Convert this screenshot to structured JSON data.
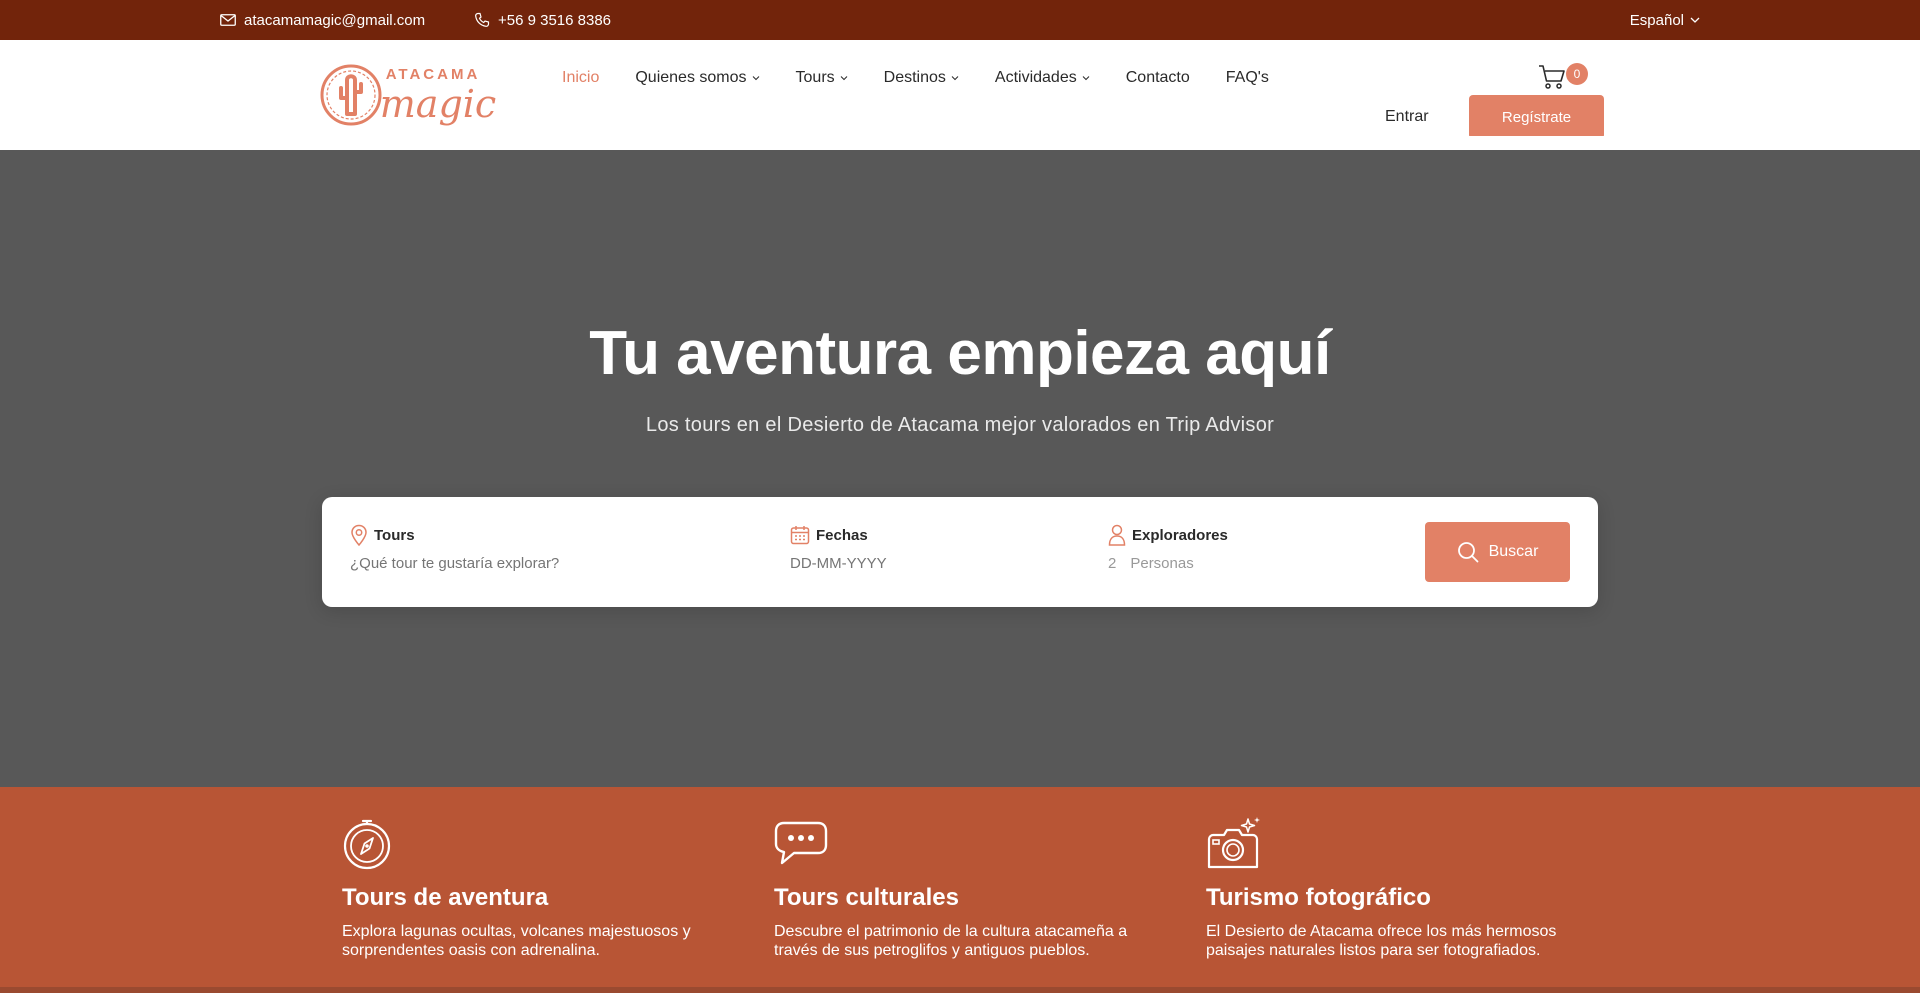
{
  "topbar": {
    "email": "atacamamagic@gmail.com",
    "phone": "+56 9 3516 8386",
    "language": "Español"
  },
  "brand": {
    "logo_top": "ATACAMA",
    "logo_main": "magic",
    "color": "#e28166"
  },
  "nav": {
    "items": [
      {
        "label": "Inicio",
        "active": true,
        "dropdown": false
      },
      {
        "label": "Quienes somos",
        "dropdown": true
      },
      {
        "label": "Tours",
        "dropdown": true
      },
      {
        "label": "Destinos",
        "dropdown": true
      },
      {
        "label": "Actividades",
        "dropdown": true
      },
      {
        "label": "Contacto",
        "dropdown": false
      },
      {
        "label": "FAQ's",
        "dropdown": false
      }
    ],
    "cart_count": "0",
    "login": "Entrar",
    "signup": "Regístrate"
  },
  "hero": {
    "title": "Tu aventura empieza aquí",
    "subtitle": "Los tours en el Desierto de Atacama mejor valorados en Trip Advisor"
  },
  "search": {
    "tours_label": "Tours",
    "tours_placeholder": "¿Qué tour te gustaría explorar?",
    "dates_label": "Fechas",
    "dates_placeholder": "DD-MM-YYYY",
    "people_label": "Exploradores",
    "people_count": "2",
    "people_unit": "Personas",
    "button": "Buscar"
  },
  "features": [
    {
      "icon": "compass-icon",
      "title": "Tours de aventura",
      "text": "Explora lagunas ocultas, volcanes majestuosos y sorprendentes oasis con adrenalina."
    },
    {
      "icon": "chat-bubble-icon",
      "title": "Tours culturales",
      "text": "Descubre el patrimonio de la cultura atacameña a través de sus petroglifos y antiguos pueblos."
    },
    {
      "icon": "camera-icon",
      "title": "Turismo fotográfico",
      "text": "El Desierto de Atacama ofrece los más hermosos paisajes naturales listos para ser fotografiados."
    }
  ],
  "colors": {
    "topbar": "#72240b",
    "accent": "#e28166",
    "hero_bg": "#585858",
    "features_bg": "#b85535"
  }
}
